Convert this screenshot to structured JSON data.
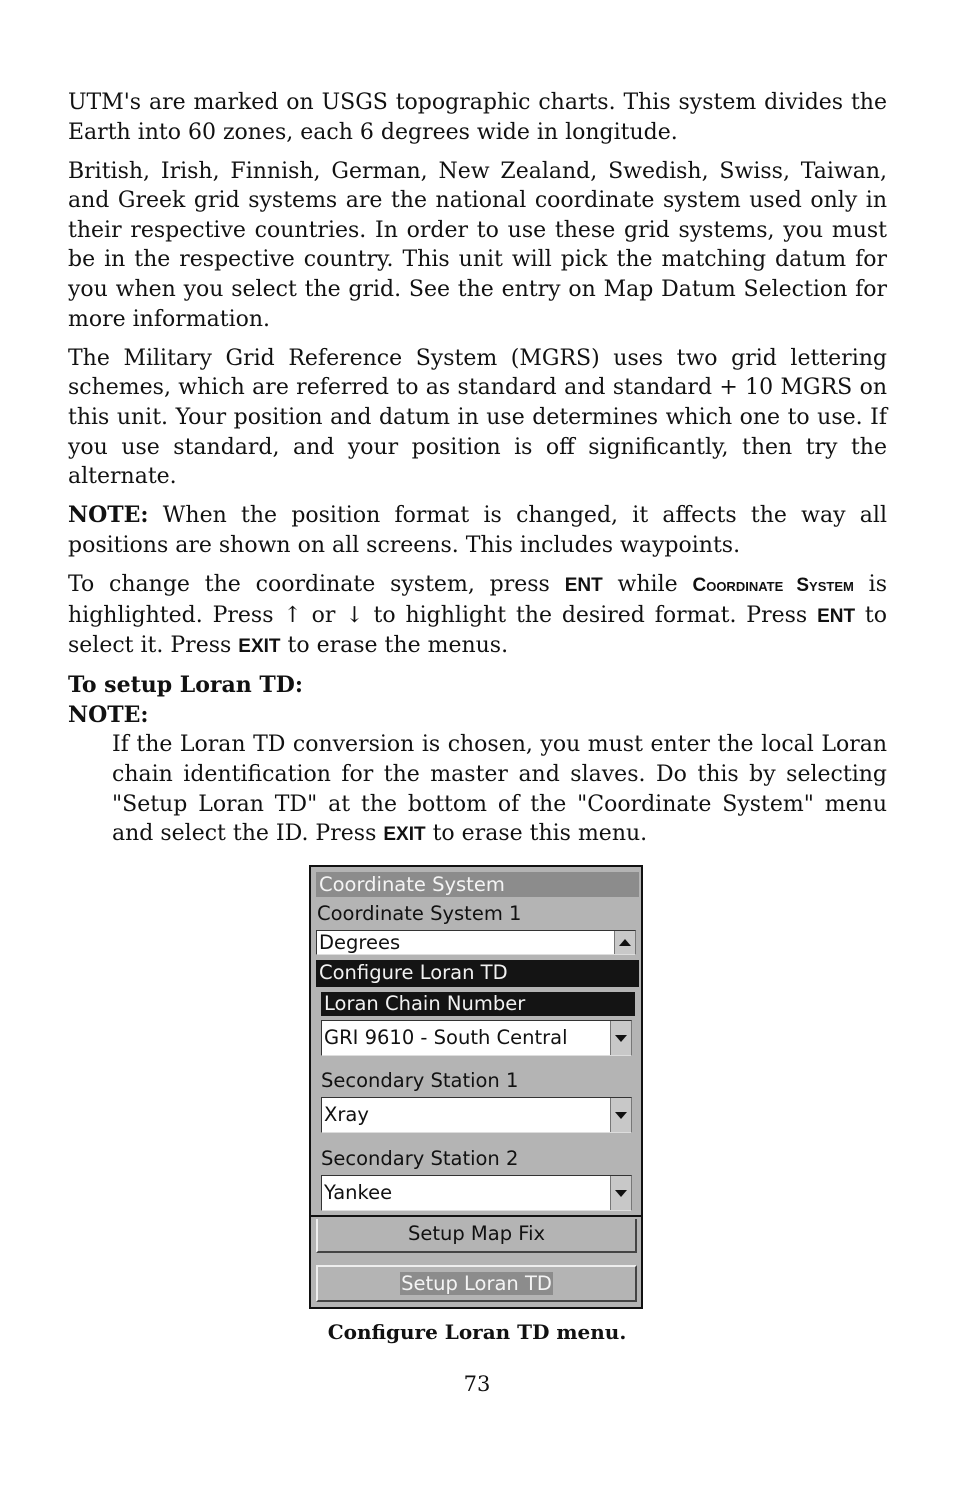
{
  "paragraphs": {
    "utm": "UTM's are marked on USGS topographic charts. This system divides the Earth into 60 zones, each 6 degrees wide in longitude.",
    "national": "British, Irish, Finnish, German, New Zealand, Swedish, Swiss, Taiwan, and Greek grid systems are the national coordinate system used only in their respective countries. In order to use these grid systems, you must be in the respective country. This unit will pick the matching datum for you when you select the grid. See the entry on Map Datum Selection for more information.",
    "mgrs": "The Military Grid Reference System (MGRS) uses two grid lettering schemes, which are referred to as standard and standard + 10 MGRS on this unit. Your position and datum in use determines which one to use. If you use standard, and your position is off significantly, then try the alternate.",
    "note_label": "NOTE:",
    "note_text": " When the position format is changed, it affects the way all positions are shown on all screens. This includes waypoints.",
    "change": {
      "t1": "To change the coordinate system, press ",
      "ent": "ENT",
      "t2": " while ",
      "coord": "Coordinate System",
      "t3": " is highlighted. Press ",
      "up": "↑",
      "t4": " or ",
      "down": "↓",
      "t5": " to highlight the desired format. Press ",
      "ent2": "ENT",
      "t6": " to select it. Press ",
      "exit": "EXIT",
      "t7": " to erase the menus."
    },
    "setup_heading": "To setup Loran TD:",
    "note2_label": "NOTE:",
    "loran": {
      "t1": "If the Loran TD conversion is chosen, you must enter the local Loran chain identification for the master and slaves. Do this by selecting \"Setup Loran TD\" at the bottom of the \"Coordinate System\" menu and select the ID. Press ",
      "exit": "EXIT",
      "t2": " to erase this menu."
    }
  },
  "device": {
    "title": "Coordinate System",
    "cs1_label": "Coordinate System 1",
    "cs1_value": "Degrees",
    "panel_title": "Configure Loran TD",
    "chain_label": "Loran Chain Number",
    "chain_value": "GRI 9610 - South Central",
    "sec1_label": "Secondary Station 1",
    "sec1_value": "Xray",
    "sec2_label": "Secondary Station 2",
    "sec2_value": "Yankee",
    "btn_map_fix": "Setup Map Fix",
    "btn_loran": "Setup Loran TD"
  },
  "caption": "Configure Loran TD menu.",
  "page_number": "73"
}
